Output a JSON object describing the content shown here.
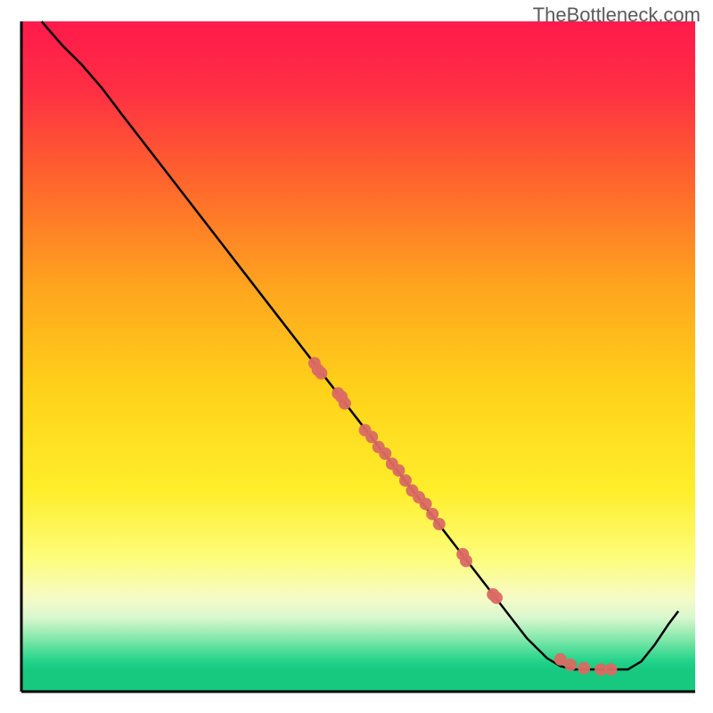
{
  "watermark": "TheBottleneck.com",
  "chart_data": {
    "type": "line",
    "title": "",
    "xlabel": "",
    "ylabel": "",
    "xlim": [
      0,
      100
    ],
    "ylim": [
      0,
      100
    ],
    "gradient_stops": [
      {
        "offset": 0.0,
        "color": "#ff1a4b"
      },
      {
        "offset": 0.1,
        "color": "#ff2e44"
      },
      {
        "offset": 0.25,
        "color": "#ff6a2b"
      },
      {
        "offset": 0.4,
        "color": "#ffa61e"
      },
      {
        "offset": 0.55,
        "color": "#ffd21a"
      },
      {
        "offset": 0.7,
        "color": "#ffee2b"
      },
      {
        "offset": 0.8,
        "color": "#fdfd7a"
      },
      {
        "offset": 0.86,
        "color": "#f6fbc6"
      },
      {
        "offset": 0.89,
        "color": "#d9f7cf"
      },
      {
        "offset": 0.92,
        "color": "#86e9ab"
      },
      {
        "offset": 0.955,
        "color": "#21d38a"
      },
      {
        "offset": 0.97,
        "color": "#17c97f"
      },
      {
        "offset": 1.0,
        "color": "#17c97f"
      }
    ],
    "curve": [
      {
        "x": 3.0,
        "y": 100.0
      },
      {
        "x": 6.0,
        "y": 96.5
      },
      {
        "x": 9.0,
        "y": 93.5
      },
      {
        "x": 12.0,
        "y": 90.0
      },
      {
        "x": 15.0,
        "y": 86.0
      },
      {
        "x": 20.0,
        "y": 79.5
      },
      {
        "x": 25.0,
        "y": 73.0
      },
      {
        "x": 30.0,
        "y": 66.5
      },
      {
        "x": 35.0,
        "y": 60.0
      },
      {
        "x": 40.0,
        "y": 53.5
      },
      {
        "x": 45.0,
        "y": 47.0
      },
      {
        "x": 50.0,
        "y": 40.5
      },
      {
        "x": 55.0,
        "y": 34.0
      },
      {
        "x": 60.0,
        "y": 27.5
      },
      {
        "x": 65.0,
        "y": 21.0
      },
      {
        "x": 70.0,
        "y": 14.5
      },
      {
        "x": 75.0,
        "y": 8.0
      },
      {
        "x": 78.0,
        "y": 5.0
      },
      {
        "x": 80.0,
        "y": 3.8
      },
      {
        "x": 82.0,
        "y": 3.3
      },
      {
        "x": 85.0,
        "y": 3.3
      },
      {
        "x": 88.0,
        "y": 3.3
      },
      {
        "x": 90.0,
        "y": 3.3
      },
      {
        "x": 92.0,
        "y": 4.5
      },
      {
        "x": 94.0,
        "y": 7.0
      },
      {
        "x": 96.0,
        "y": 10.0
      },
      {
        "x": 97.5,
        "y": 12.0
      }
    ],
    "points": [
      {
        "x": 43.5,
        "y": 49.0
      },
      {
        "x": 44.0,
        "y": 48.0
      },
      {
        "x": 44.5,
        "y": 47.5
      },
      {
        "x": 47.0,
        "y": 44.5
      },
      {
        "x": 47.5,
        "y": 44.0
      },
      {
        "x": 48.0,
        "y": 43.0
      },
      {
        "x": 51.0,
        "y": 39.0
      },
      {
        "x": 52.0,
        "y": 38.0
      },
      {
        "x": 53.0,
        "y": 36.5
      },
      {
        "x": 54.0,
        "y": 35.5
      },
      {
        "x": 55.0,
        "y": 34.0
      },
      {
        "x": 56.0,
        "y": 33.0
      },
      {
        "x": 57.0,
        "y": 31.5
      },
      {
        "x": 58.0,
        "y": 30.0
      },
      {
        "x": 59.0,
        "y": 29.0
      },
      {
        "x": 60.0,
        "y": 28.0
      },
      {
        "x": 61.0,
        "y": 26.5
      },
      {
        "x": 62.0,
        "y": 25.0
      },
      {
        "x": 65.5,
        "y": 20.5
      },
      {
        "x": 66.0,
        "y": 19.5
      },
      {
        "x": 70.0,
        "y": 14.5
      },
      {
        "x": 70.5,
        "y": 14.0
      },
      {
        "x": 80.0,
        "y": 4.8
      },
      {
        "x": 81.5,
        "y": 4.0
      },
      {
        "x": 83.5,
        "y": 3.5
      },
      {
        "x": 86.0,
        "y": 3.3
      },
      {
        "x": 87.5,
        "y": 3.3
      }
    ],
    "point_color": "#da6a63",
    "line_color": "#000000",
    "axis_color": "#000000"
  }
}
